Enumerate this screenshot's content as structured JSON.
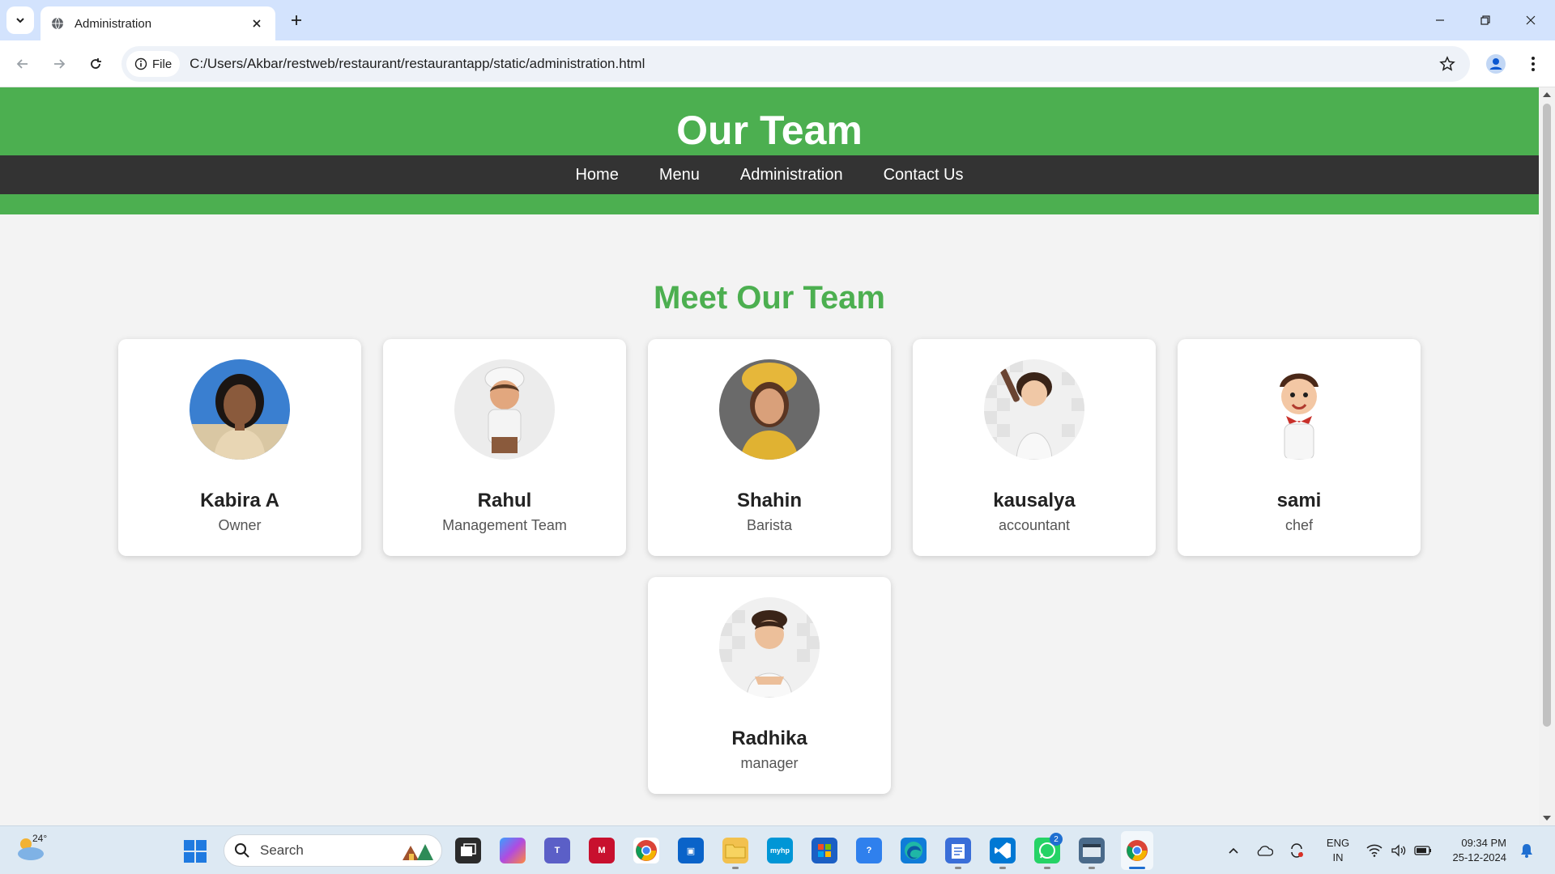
{
  "browser": {
    "tab_title": "Administration",
    "site_chip": "File",
    "url": "C:/Users/Akbar/restweb/restaurant/restaurantapp/static/administration.html"
  },
  "page": {
    "header_title": "Our Team",
    "nav": [
      "Home",
      "Menu",
      "Administration",
      "Contact Us"
    ],
    "section_title": "Meet Our Team",
    "team": [
      {
        "name": "Kabira A",
        "role": "Owner"
      },
      {
        "name": "Rahul",
        "role": "Management Team"
      },
      {
        "name": "Shahin",
        "role": "Barista"
      },
      {
        "name": "kausalya",
        "role": "accountant"
      },
      {
        "name": "sami",
        "role": "chef"
      },
      {
        "name": "Radhika",
        "role": "manager"
      }
    ],
    "colors": {
      "header_green": "#4caf50",
      "nav_dark": "#333333"
    }
  },
  "taskbar": {
    "weather_temp": "24°",
    "search_placeholder": "Search",
    "whatsapp_badge": "2",
    "lang_line1": "ENG",
    "lang_line2": "IN",
    "time": "09:34 PM",
    "date": "25-12-2024"
  }
}
